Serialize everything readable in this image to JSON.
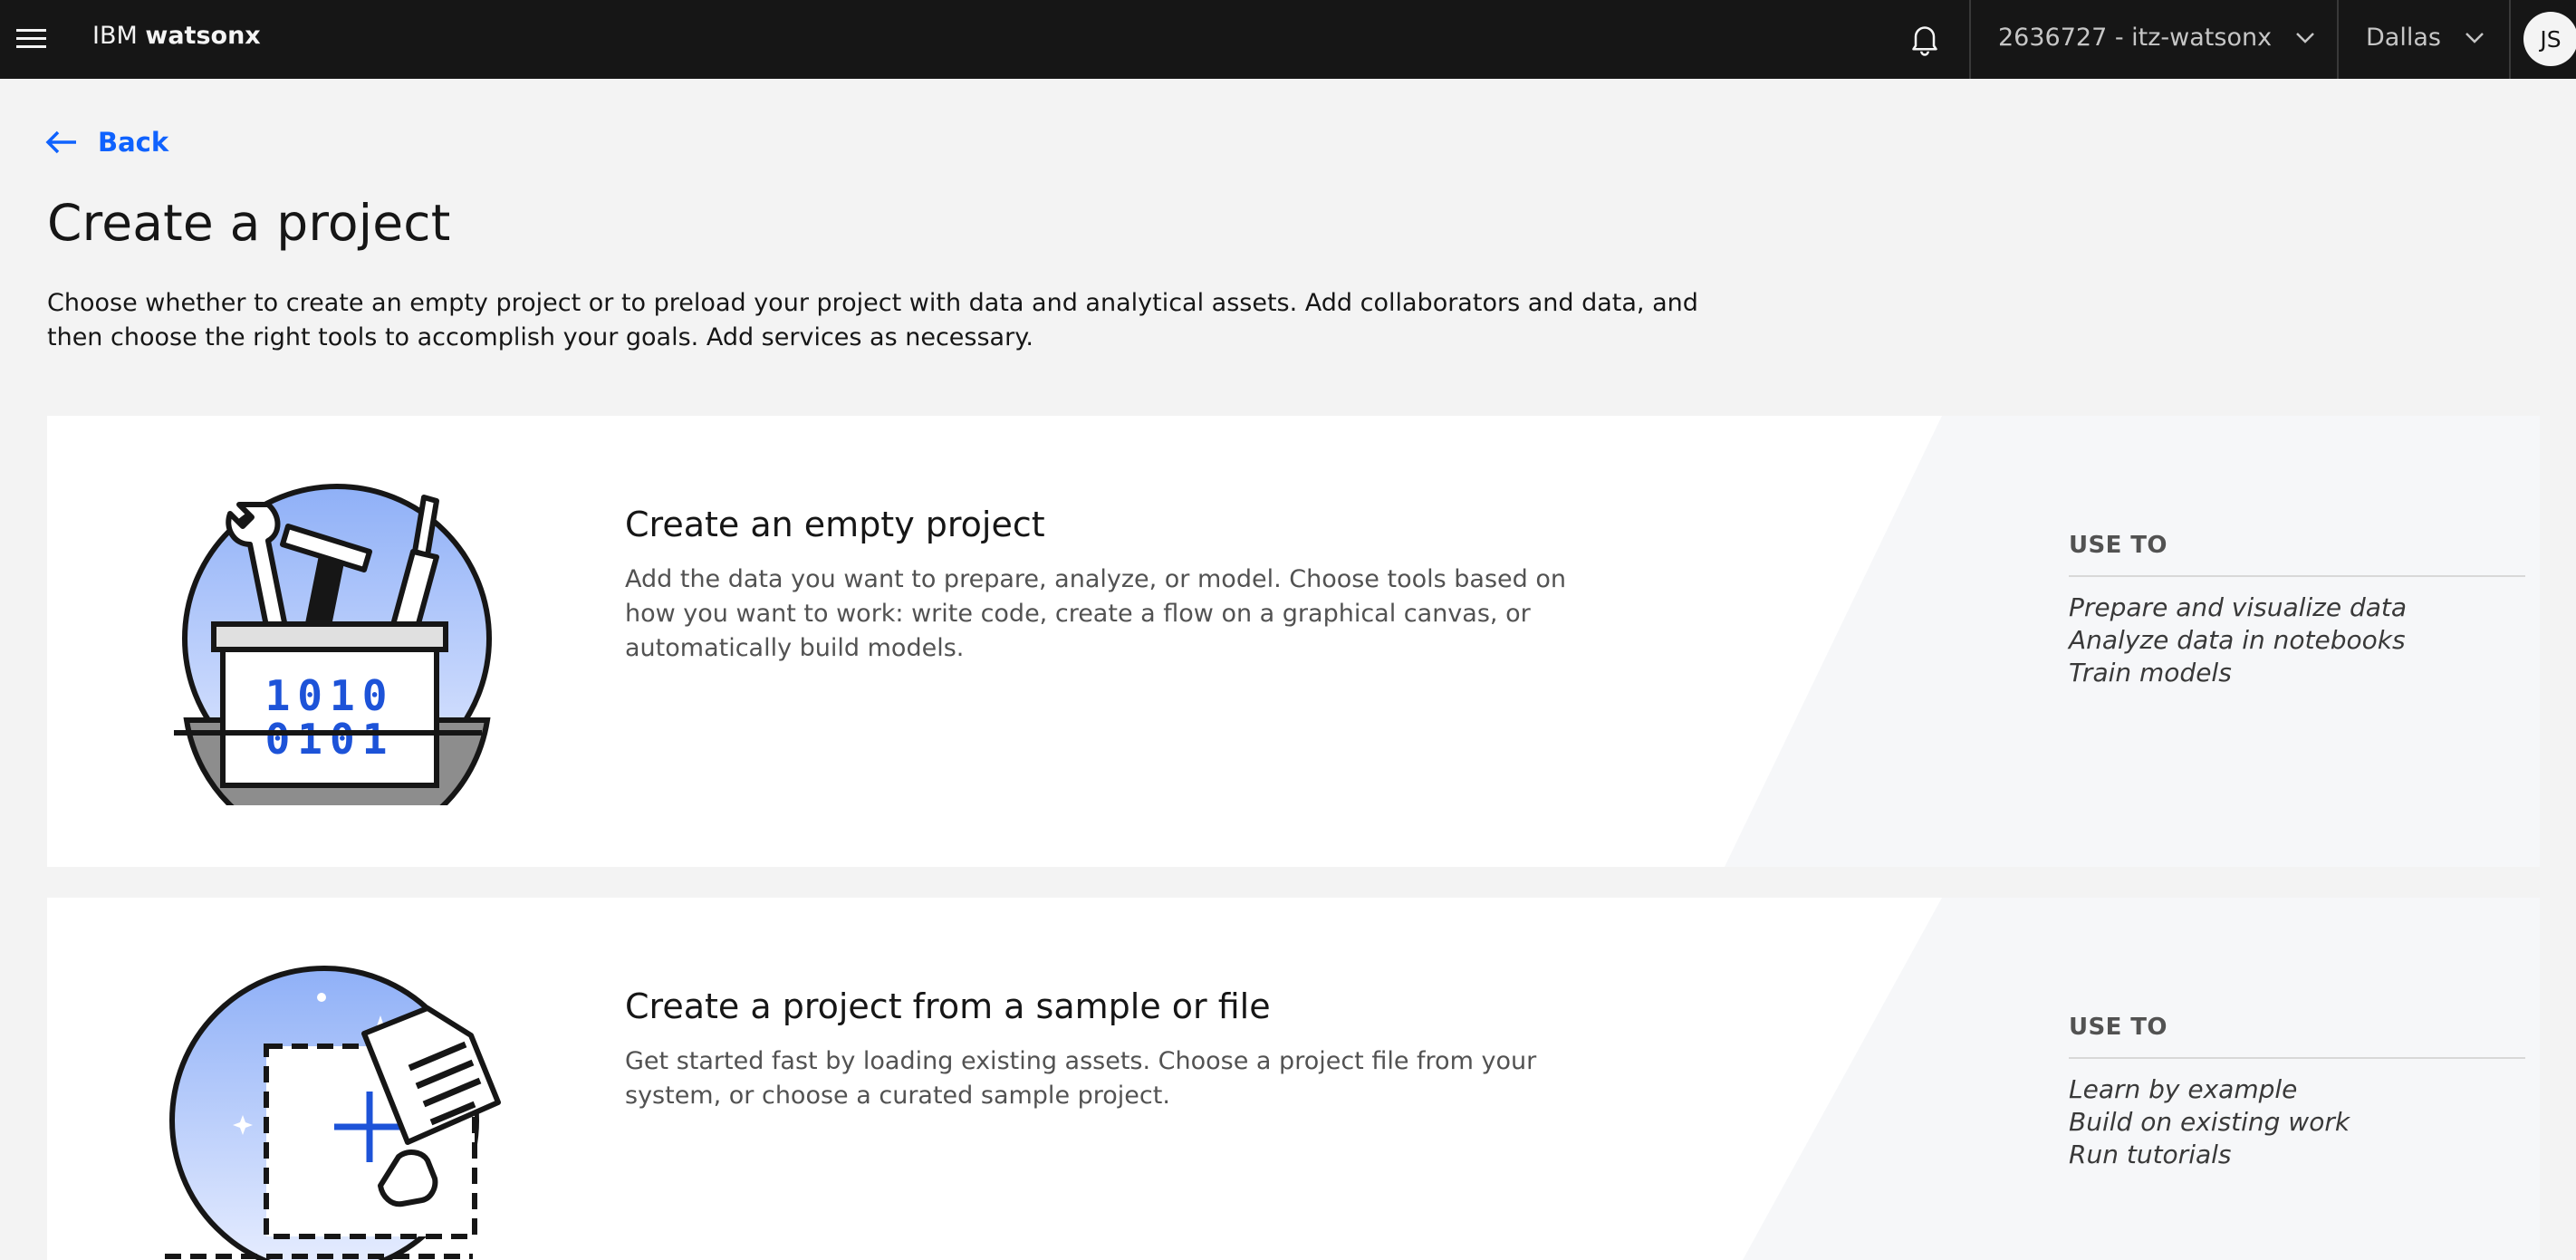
{
  "header": {
    "brand_prefix": "IBM",
    "brand_name": "watsonx",
    "account": "2636727 - itz-watsonx",
    "region": "Dallas",
    "avatar_initials": "JS"
  },
  "back_label": "Back",
  "page_title": "Create a project",
  "intro": "Choose whether to create an empty project or to preload your project with data and analytical assets. Add collaborators and data, and then choose the right tools to accomplish your goals. Add services as necessary.",
  "cards": [
    {
      "title": "Create an empty project",
      "description": "Add the data you want to prepare, analyze, or model. Choose tools based on how you want to work: write code, create a flow on a graphical canvas, or automatically build models.",
      "use_to_label": "USE TO",
      "use_to": [
        "Prepare and visualize data",
        "Analyze data in notebooks",
        "Train models"
      ],
      "illustration_text": [
        "1010",
        "0101"
      ]
    },
    {
      "title": "Create a project from a sample or file",
      "description": "Get started fast by loading existing assets. Choose a project file from your system, or choose a curated sample project.",
      "use_to_label": "USE TO",
      "use_to": [
        "Learn by example",
        "Build on existing work",
        "Run tutorials"
      ]
    }
  ],
  "colors": {
    "header_bg": "#161616",
    "link": "#0f62fe",
    "page_bg": "#f3f3f3",
    "card_bg": "#ffffff"
  }
}
